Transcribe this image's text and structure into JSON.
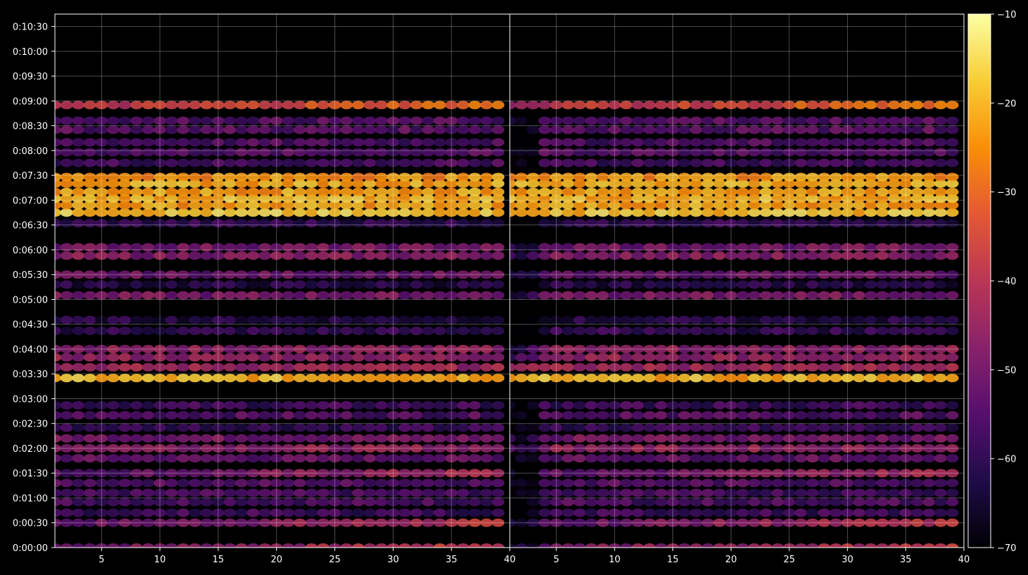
{
  "chart_data": {
    "type": "heatmap",
    "title": "",
    "xlabel": "",
    "ylabel": "",
    "panels": [
      {
        "name": "",
        "x_ticks": [
          5,
          10,
          15,
          20,
          25,
          30,
          35,
          40
        ],
        "x_range": [
          1,
          40
        ]
      },
      {
        "name": "",
        "x_ticks": [
          5,
          10,
          15,
          20,
          25,
          30,
          35,
          40
        ],
        "x_range": [
          1,
          40
        ]
      }
    ],
    "y_ticks": [
      "0:00:00",
      "0:00:30",
      "0:01:00",
      "0:01:30",
      "0:02:00",
      "0:02:30",
      "0:03:00",
      "0:03:30",
      "0:04:00",
      "0:04:30",
      "0:05:00",
      "0:05:30",
      "0:06:00",
      "0:06:30",
      "0:07:00",
      "0:07:30",
      "0:08:00",
      "0:08:30",
      "0:09:00",
      "0:09:30",
      "0:10:00",
      "0:10:30"
    ],
    "y_range_seconds": [
      0,
      645
    ],
    "grid": true,
    "colormap": "inferno",
    "colorbar": {
      "min": -70,
      "max": -10,
      "ticks": [
        -10,
        -20,
        -30,
        -40,
        -50,
        -60,
        -70
      ]
    },
    "marker": "ellipse",
    "x_count": 39,
    "bands": [
      {
        "t": 0,
        "level": -48,
        "ramp": 1
      },
      {
        "t": 30,
        "level": -50,
        "ramp": 1
      },
      {
        "t": 42,
        "level": -58,
        "ramp": 0
      },
      {
        "t": 55,
        "level": -56,
        "ramp": 0
      },
      {
        "t": 66,
        "level": -57,
        "ramp": 0
      },
      {
        "t": 78,
        "level": -55,
        "ramp": 0
      },
      {
        "t": 90,
        "level": -52,
        "ramp": 1
      },
      {
        "t": 108,
        "level": -53,
        "ramp": 0
      },
      {
        "t": 120,
        "level": -46,
        "ramp": 0
      },
      {
        "t": 132,
        "level": -50,
        "ramp": 0
      },
      {
        "t": 145,
        "level": -59,
        "ramp": 0
      },
      {
        "t": 160,
        "level": -55,
        "ramp": 0
      },
      {
        "t": 172,
        "level": -58,
        "ramp": 0
      },
      {
        "t": 205,
        "level": -20,
        "ramp": 0
      },
      {
        "t": 218,
        "level": -44,
        "ramp": 0
      },
      {
        "t": 230,
        "level": -46,
        "ramp": 0
      },
      {
        "t": 240,
        "level": -47,
        "ramp": 0
      },
      {
        "t": 262,
        "level": -60,
        "ramp": 0
      },
      {
        "t": 275,
        "level": -62,
        "ramp": 0
      },
      {
        "t": 305,
        "level": -50,
        "ramp": 0
      },
      {
        "t": 318,
        "level": -62,
        "ramp": 0
      },
      {
        "t": 330,
        "level": -52,
        "ramp": 0
      },
      {
        "t": 353,
        "level": -48,
        "ramp": 0
      },
      {
        "t": 363,
        "level": -50,
        "ramp": 0
      },
      {
        "t": 392,
        "level": -60,
        "ramp": 0
      },
      {
        "t": 405,
        "level": -18,
        "ramp": 0
      },
      {
        "t": 414,
        "level": -22,
        "ramp": 0
      },
      {
        "t": 422,
        "level": -20,
        "ramp": 0
      },
      {
        "t": 430,
        "level": -22,
        "ramp": 0
      },
      {
        "t": 440,
        "level": -21,
        "ramp": 0
      },
      {
        "t": 448,
        "level": -24,
        "ramp": 0
      },
      {
        "t": 465,
        "level": -57,
        "ramp": 0
      },
      {
        "t": 478,
        "level": -55,
        "ramp": 0
      },
      {
        "t": 490,
        "level": -56,
        "ramp": 0
      },
      {
        "t": 505,
        "level": -54,
        "ramp": 0
      },
      {
        "t": 516,
        "level": -55,
        "ramp": 0
      },
      {
        "t": 535,
        "level": -38,
        "ramp": 1
      }
    ]
  }
}
